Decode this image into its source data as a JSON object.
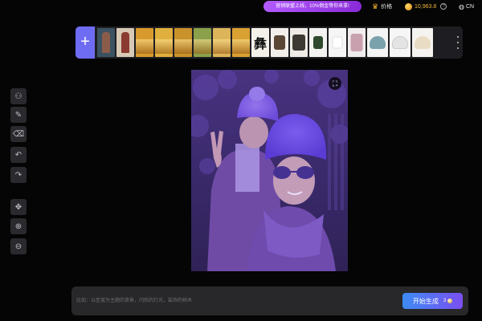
{
  "topbar": {
    "promo_text": "营销联盟上线，10%佣金等你来拿!",
    "pricing_label": "价格",
    "credits": "10,963.8",
    "help": "?",
    "language": "CN"
  },
  "strip": {
    "add_label": "+",
    "thumbnails": [
      {
        "name": "model-photo-1",
        "color": "#3b5262"
      },
      {
        "name": "model-photo-2",
        "color": "#d8c9b6"
      },
      {
        "name": "golden-field-1",
        "color": "#d89a2c"
      },
      {
        "name": "golden-field-2",
        "color": "#e0b03e"
      },
      {
        "name": "golden-field-3",
        "color": "#c9922a"
      },
      {
        "name": "golden-field-4",
        "color": "#8aa04a"
      },
      {
        "name": "golden-field-5",
        "color": "#dcb55a"
      },
      {
        "name": "golden-field-6",
        "color": "#d9a032"
      },
      {
        "name": "calligraphy",
        "color": "#f4f1ea"
      },
      {
        "name": "brown-sweater",
        "color": "#f2efea"
      },
      {
        "name": "dark-sweater",
        "color": "#efece7"
      },
      {
        "name": "green-cardigan",
        "color": "#f3f3f1"
      },
      {
        "name": "white-blouse",
        "color": "#f6f6f6"
      },
      {
        "name": "pink-hoodie",
        "color": "#f1ecee"
      },
      {
        "name": "teal-chair",
        "color": "#f4f4f4"
      },
      {
        "name": "white-bowl-chair",
        "color": "#f6f6f6"
      },
      {
        "name": "cream-chair",
        "color": "#f5f3ef"
      }
    ]
  },
  "tools": [
    {
      "name": "select-person-icon",
      "glyph": "⚇"
    },
    {
      "name": "brush-icon",
      "glyph": "✎"
    },
    {
      "name": "eraser-icon",
      "glyph": "⌫"
    },
    {
      "name": "undo-icon",
      "glyph": "↶"
    },
    {
      "name": "redo-icon",
      "glyph": "↷"
    },
    {
      "name": "move-icon",
      "glyph": "✥"
    },
    {
      "name": "zoom-in-icon",
      "glyph": "⊕"
    },
    {
      "name": "zoom-out-icon",
      "glyph": "⊖"
    }
  ],
  "canvas": {
    "crop_icon": "⛶"
  },
  "prompt": {
    "placeholder": "比如：以圣诞为主题的背景，闪烁的灯光，装饰的树木",
    "value": "",
    "generate_label": "开始生成",
    "cost": "3"
  },
  "colors": {
    "accent": "#6f6cf4",
    "promo": "#a24ef0",
    "gold": "#f0b93b",
    "overlay": "#7a55e0"
  }
}
